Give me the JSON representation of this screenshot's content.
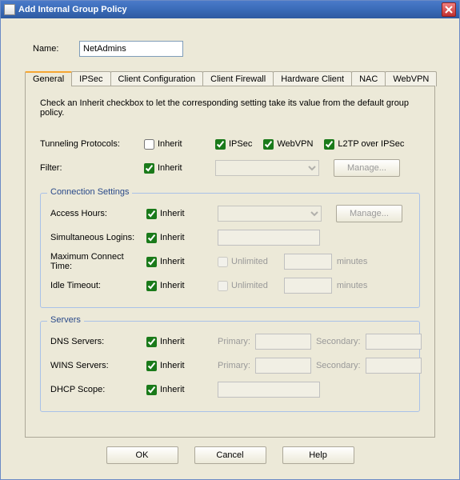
{
  "window": {
    "title": "Add Internal Group Policy"
  },
  "name_field": {
    "label": "Name:",
    "value": "NetAdmins"
  },
  "tabs": {
    "general": "General",
    "ipsec": "IPSec",
    "client_config": "Client Configuration",
    "client_firewall": "Client Firewall",
    "hardware_client": "Hardware Client",
    "nac": "NAC",
    "webvpn": "WebVPN"
  },
  "intro": "Check an Inherit checkbox to let the corresponding setting take its value from the default group policy.",
  "labels": {
    "tunneling_protocols": "Tunneling Protocols:",
    "filter": "Filter:",
    "inherit": "Inherit",
    "ipsec": "IPSec",
    "webvpn": "WebVPN",
    "l2tp": "L2TP over IPSec",
    "manage": "Manage...",
    "connection_settings": "Connection Settings",
    "access_hours": "Access Hours:",
    "simultaneous_logins": "Simultaneous Logins:",
    "max_connect": "Maximum Connect Time:",
    "idle_timeout": "Idle Timeout:",
    "unlimited": "Unlimited",
    "minutes": "minutes",
    "servers": "Servers",
    "dns_servers": "DNS Servers:",
    "wins_servers": "WINS Servers:",
    "dhcp_scope": "DHCP Scope:",
    "primary": "Primary:",
    "secondary": "Secondary:"
  },
  "checkboxes": {
    "tunneling_inherit": false,
    "tunneling_ipsec": true,
    "tunneling_webvpn": true,
    "tunneling_l2tp": true,
    "filter_inherit": true,
    "access_hours_inherit": true,
    "sim_logins_inherit": true,
    "max_connect_inherit": true,
    "max_connect_unlimited": false,
    "idle_timeout_inherit": true,
    "idle_timeout_unlimited": false,
    "dns_inherit": true,
    "wins_inherit": true,
    "dhcp_inherit": true
  },
  "footer": {
    "ok": "OK",
    "cancel": "Cancel",
    "help": "Help"
  }
}
